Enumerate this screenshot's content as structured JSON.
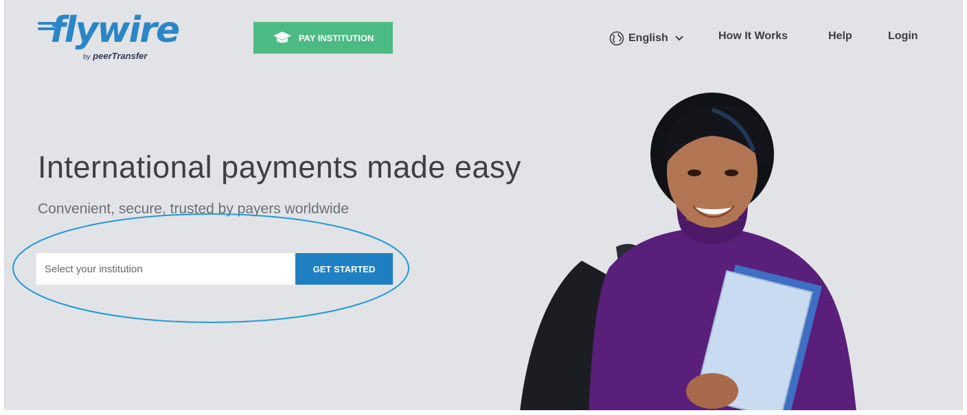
{
  "header": {
    "logo_text": "flywire",
    "logo_by": "by",
    "logo_brand": "peerTransfer",
    "pay_button": "PAY INSTITUTION",
    "language": "English",
    "nav": {
      "how_it_works": "How It Works",
      "help": "Help",
      "login": "Login"
    }
  },
  "hero": {
    "title": "International payments made easy",
    "subtitle": "Convenient, secure, trusted by payers worldwide",
    "search_placeholder": "Select your institution",
    "search_value": "",
    "cta": "GET STARTED"
  },
  "icons": {
    "pay_button": "graduation-cap-icon",
    "language": "globe-icon",
    "dropdown": "chevron-down-icon"
  },
  "colors": {
    "brand_blue": "#2a86c7",
    "pay_green": "#4cba83",
    "cta_blue": "#1f7fc3",
    "background": "#e2e3e7",
    "annotation_ellipse": "#1e9ad6"
  }
}
